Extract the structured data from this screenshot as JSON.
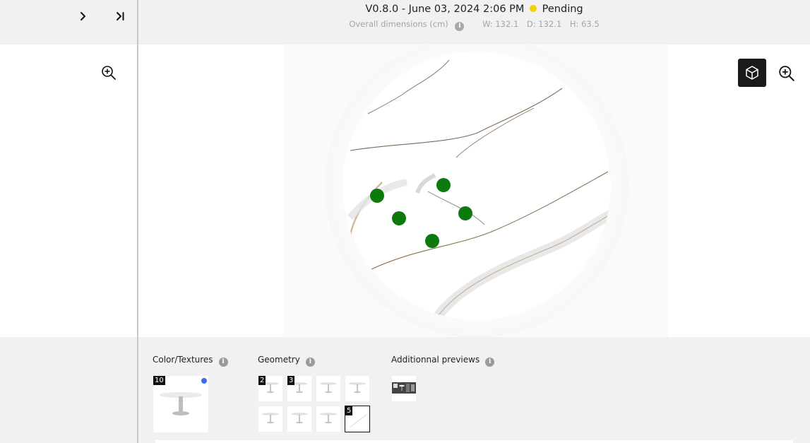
{
  "nav": {
    "expand_icon": "chevron-right-icon",
    "expand_end_icon": "chevron-right-end-icon",
    "zoom_icon": "zoom-in-icon"
  },
  "header": {
    "version_text": "V0.8.0 - June 03, 2024 2:06 PM",
    "status_label": "Pending",
    "status_color": "#f5d000",
    "dims_label": "Overall dimensions (cm)",
    "dims_info": "i",
    "width": "W: 132.1",
    "depth": "D: 132.1",
    "height": "H: 63.5"
  },
  "viewer": {
    "view_3d_icon": "cube-icon",
    "zoom_icon": "zoom-in-icon",
    "hotspot_count": 5,
    "hotspot_color": "#0c7a0c"
  },
  "sections": {
    "textures": {
      "title": "Color/Textures",
      "info": "i"
    },
    "geometry": {
      "title": "Geometry",
      "info": "i"
    },
    "previews": {
      "title": "Additionnal previews",
      "info": "i"
    }
  },
  "textures": [
    {
      "badge": "10",
      "selected": false,
      "has_dot": true,
      "dot_color": "#3b6cf0"
    }
  ],
  "geometry": [
    {
      "badge": "2"
    },
    {
      "badge": "3"
    },
    {
      "badge": ""
    },
    {
      "badge": ""
    },
    {
      "badge": ""
    },
    {
      "badge": ""
    },
    {
      "badge": ""
    },
    {
      "badge": "5",
      "selected": true
    }
  ],
  "previews": [
    {
      "badge": ""
    }
  ]
}
